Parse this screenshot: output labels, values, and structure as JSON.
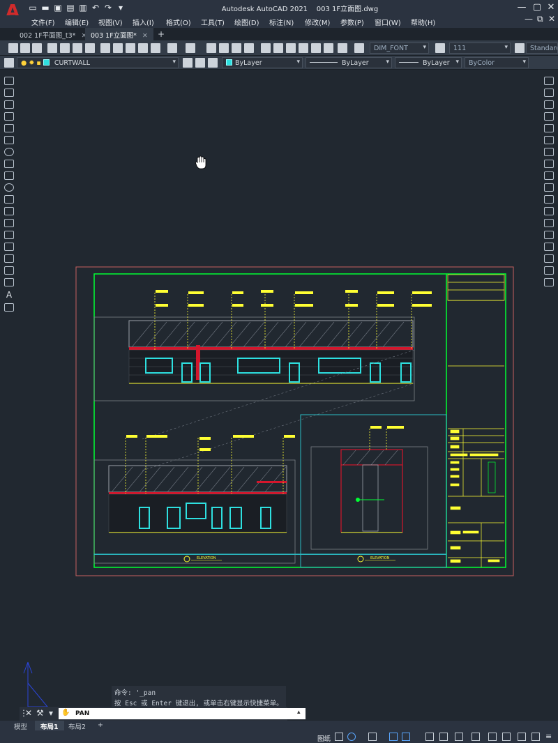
{
  "app": {
    "title": "Autodesk AutoCAD 2021",
    "document": "003 1F立面图.dwg",
    "logo_letter": "A"
  },
  "menu": [
    "文件(F)",
    "编辑(E)",
    "视图(V)",
    "插入(I)",
    "格式(O)",
    "工具(T)",
    "绘图(D)",
    "标注(N)",
    "修改(M)",
    "参数(P)",
    "窗口(W)",
    "帮助(H)"
  ],
  "tabs": [
    {
      "label": "002 1F平面图_t3*",
      "active": false
    },
    {
      "label": "003 1F立面图*",
      "active": true
    }
  ],
  "toolbar": {
    "dim_style": "DIM_FONT",
    "scale": "111",
    "table_style": "Standard",
    "layer": "CURTWALL",
    "color": "ByLayer",
    "linetype": "ByLayer",
    "lineweight": "ByLayer",
    "plot_style": "ByColor"
  },
  "drawing": {
    "elevation_label_1": "ELEVATION",
    "elevation_label_2": "ELEVATION",
    "colors": {
      "sheet_border": "#c86060",
      "frame": "#00ff33",
      "viewport": "#2bbcc4",
      "furniture": "#2ee0e0",
      "annotation": "#ffff00",
      "wall_red": "#d4162c"
    }
  },
  "command": {
    "history": [
      "命令: '_pan",
      "按 Esc 或 Enter 键退出, 或单击右键显示快捷菜单。"
    ],
    "input_value": "PAN"
  },
  "layout_tabs": [
    {
      "label": "模型",
      "active": false
    },
    {
      "label": "布局1",
      "active": true
    },
    {
      "label": "布局2",
      "active": false
    }
  ],
  "status": {
    "space": "图纸"
  }
}
